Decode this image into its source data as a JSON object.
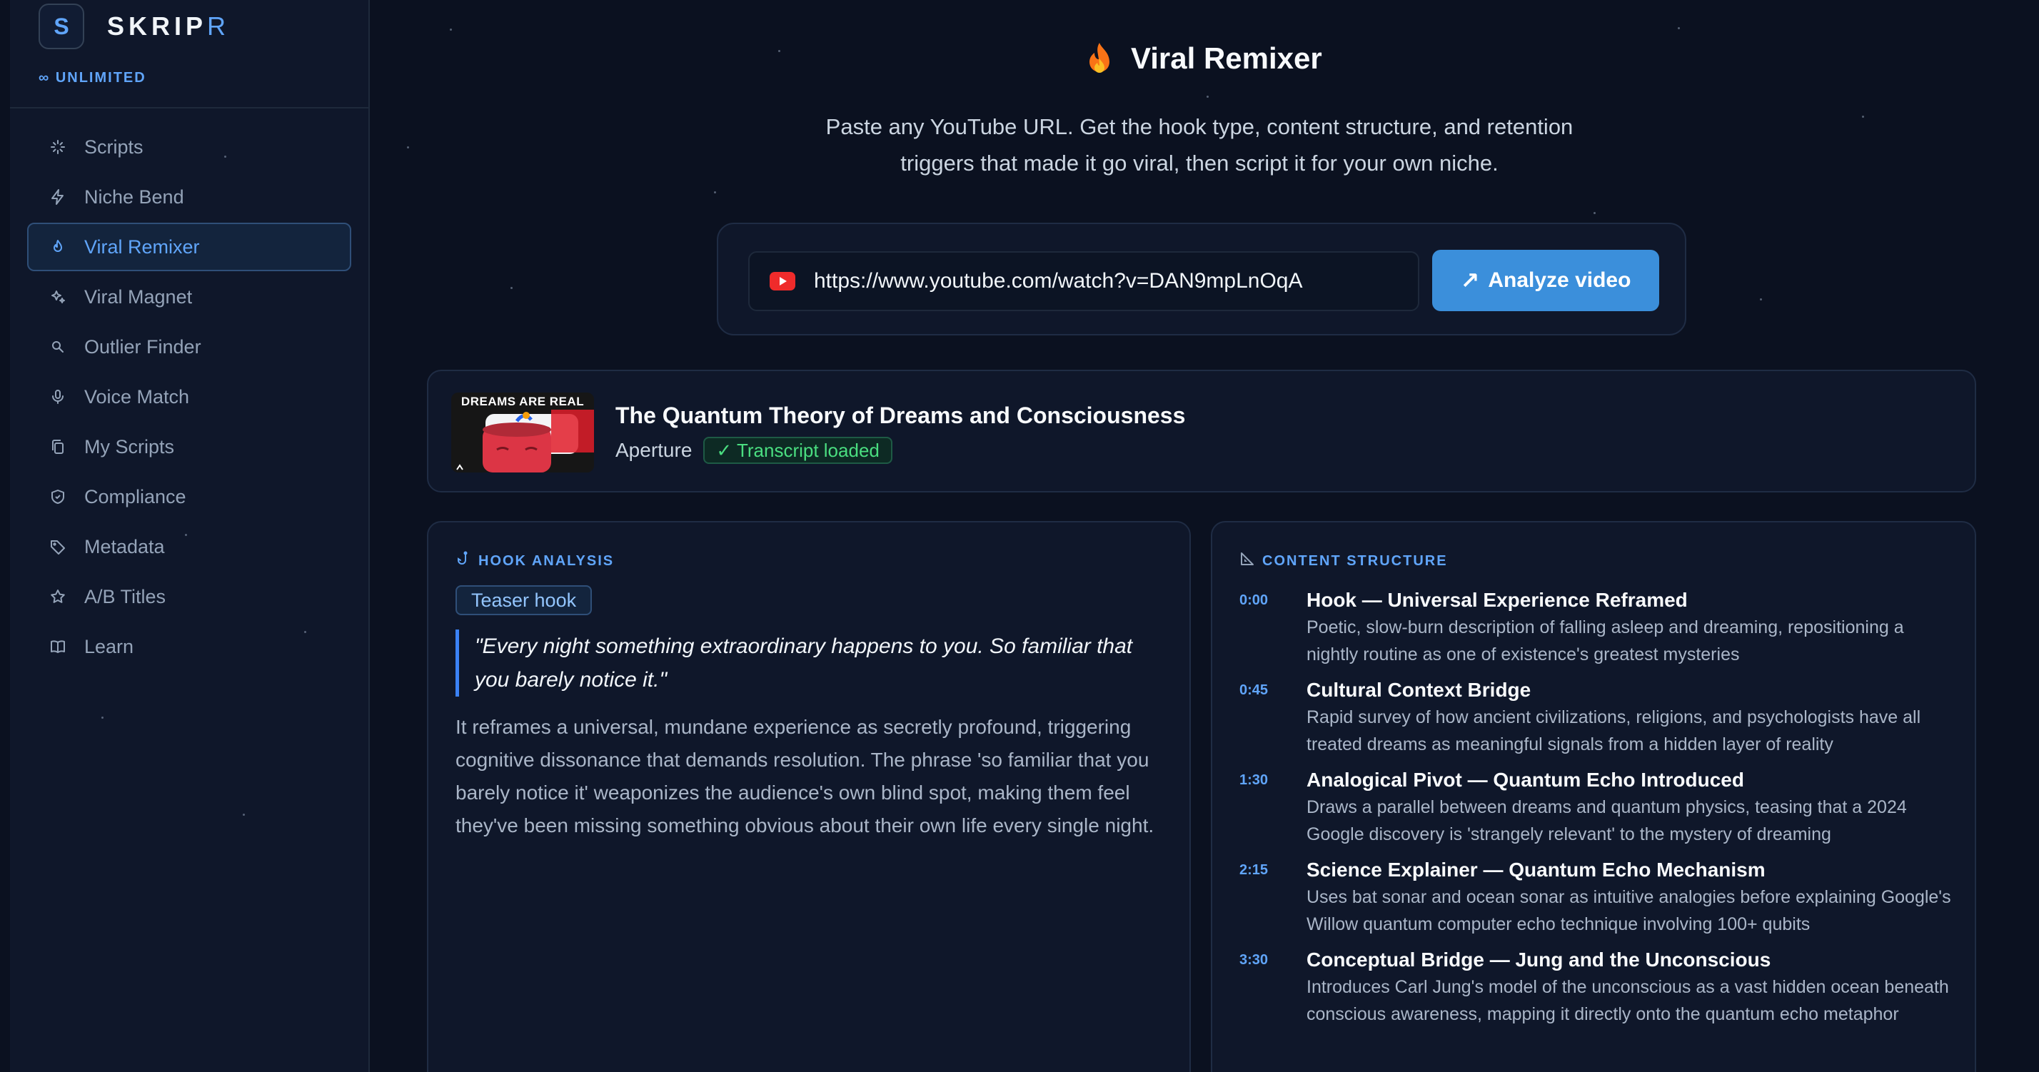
{
  "sidebar": {
    "brand_letter": "S",
    "brand_name_main": "SKRIP",
    "brand_name_last": "R",
    "plan": "∞ UNLIMITED",
    "items": [
      {
        "label": "Scripts",
        "icon": "sparkle-icon"
      },
      {
        "label": "Niche Bend",
        "icon": "lightning-icon"
      },
      {
        "label": "Viral Remixer",
        "icon": "flame-icon",
        "active": true
      },
      {
        "label": "Viral Magnet",
        "icon": "stars-icon"
      },
      {
        "label": "Outlier Finder",
        "icon": "search-icon"
      },
      {
        "label": "Voice Match",
        "icon": "microphone-icon"
      },
      {
        "label": "My Scripts",
        "icon": "copy-icon"
      },
      {
        "label": "Compliance",
        "icon": "shield-icon"
      },
      {
        "label": "Metadata",
        "icon": "tag-icon"
      },
      {
        "label": "A/B Titles",
        "icon": "star-icon"
      },
      {
        "label": "Learn",
        "icon": "book-icon"
      }
    ]
  },
  "header": {
    "title": "Viral Remixer",
    "subtitle": "Paste any YouTube URL. Get the hook type, content structure, and retention triggers that made it go viral, then script it for your own niche."
  },
  "url_form": {
    "value": "https://www.youtube.com/watch?v=DAN9mpLnOqA",
    "button_label": "Analyze video"
  },
  "video": {
    "thumbnail_text": "DREAMS ARE REAL",
    "title": "The Quantum Theory of Dreams and Consciousness",
    "channel": "Aperture",
    "status": "✓ Transcript loaded"
  },
  "hook_analysis": {
    "heading": "HOOK ANALYSIS",
    "type": "Teaser hook",
    "quote": "\"Every night something extraordinary happens to you. So familiar that you barely notice it.\"",
    "explanation": "It reframes a universal, mundane experience as secretly profound, triggering cognitive dissonance that demands resolution. The phrase 'so familiar that you barely notice it' weaponizes the audience's own blind spot, making them feel they've been missing something obvious about their own life every single night."
  },
  "content_structure": {
    "heading": "CONTENT STRUCTURE",
    "sections": [
      {
        "time": "0:00",
        "title": "Hook — Universal Experience Reframed",
        "desc": "Poetic, slow-burn description of falling asleep and dreaming, repositioning a nightly routine as one of existence's greatest mysteries"
      },
      {
        "time": "0:45",
        "title": "Cultural Context Bridge",
        "desc": "Rapid survey of how ancient civilizations, religions, and psychologists have all treated dreams as meaningful signals from a hidden layer of reality"
      },
      {
        "time": "1:30",
        "title": "Analogical Pivot — Quantum Echo Introduced",
        "desc": "Draws a parallel between dreams and quantum physics, teasing that a 2024 Google discovery is 'strangely relevant' to the mystery of dreaming"
      },
      {
        "time": "2:15",
        "title": "Science Explainer — Quantum Echo Mechanism",
        "desc": "Uses bat sonar and ocean sonar as intuitive analogies before explaining Google's Willow quantum computer echo technique involving 100+ qubits"
      },
      {
        "time": "3:30",
        "title": "Conceptual Bridge — Jung and the Unconscious",
        "desc": "Introduces Carl Jung's model of the unconscious as a vast hidden ocean beneath conscious awareness, mapping it directly onto the quantum echo metaphor"
      }
    ]
  },
  "colors": {
    "background": "#0b1120",
    "sidebar": "#0f172a",
    "accent": "#60a5fa",
    "button": "#3b8fdb",
    "success": "#4ade80",
    "youtube": "#ef2b2b"
  }
}
